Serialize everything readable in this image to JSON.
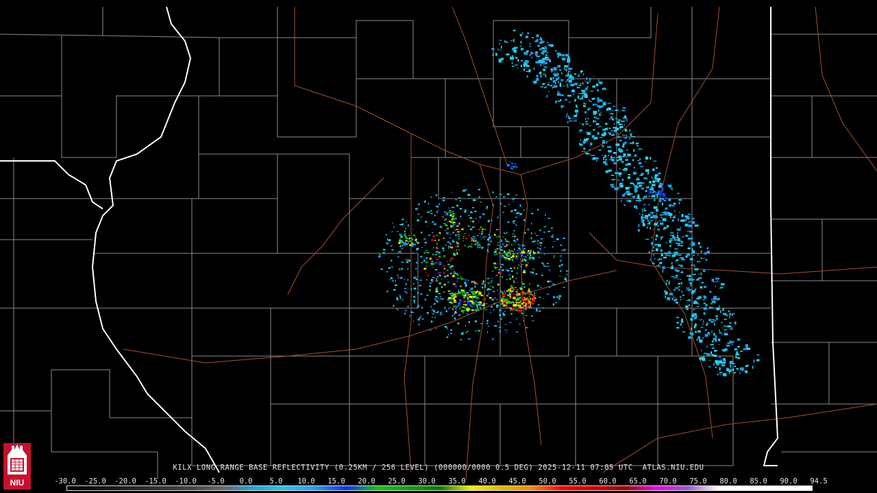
{
  "product": {
    "caption": "KILX LONG RANGE BASE REFLECTIVITY (0.25KM / 256 LEVEL) (000000/0000 0.5 DEG) 2025-12-11 07:05 UTC  ATLAS.NIU.EDU"
  },
  "scale": {
    "labels": [
      "-30.0",
      "-25.0",
      "-20.0",
      "-15.0",
      "-10.0",
      "-5.0",
      "0.0",
      "5.0",
      "10.0",
      "15.0",
      "20.0",
      "25.0",
      "30.0",
      "35.0",
      "40.0",
      "45.0",
      "50.0",
      "55.0",
      "60.0",
      "65.0",
      "70.0",
      "75.0",
      "80.0",
      "85.0",
      "90.0",
      "94.5"
    ],
    "colors": [
      "#000000",
      "#111111",
      "#222222",
      "#333333",
      "#444444",
      "#666666",
      "#1aa8d6",
      "#22c8e8",
      "#1ea0f0",
      "#1030f0",
      "#10c810",
      "#0ea00e",
      "#0a780a",
      "#f0f000",
      "#e0b800",
      "#f08800",
      "#f00000",
      "#c80000",
      "#a00000",
      "#f000f0",
      "#9858c8",
      "#ffffff",
      "#ffffff",
      "#ffffff",
      "#ffffff"
    ]
  },
  "logo": {
    "text": "NIU",
    "name": "niu-logo-icon"
  },
  "colors": {
    "state_border": "#ffffff",
    "county_border": "#9a9a9a",
    "highway": "#a0522d",
    "background": "#000000"
  }
}
